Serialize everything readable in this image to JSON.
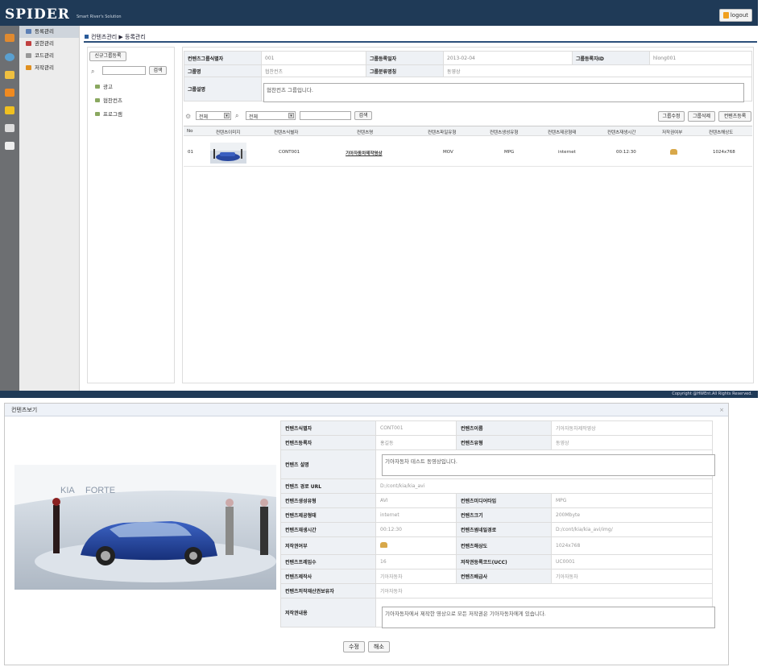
{
  "app": {
    "logo": "SPIDER",
    "tagline": "Smart River's Solution",
    "logout_label": "logout"
  },
  "sidebar": {
    "items": [
      {
        "label": "등록관리",
        "color": "#5b7fb5"
      },
      {
        "label": "권한관리",
        "color": "#c04040"
      },
      {
        "label": "코드관리",
        "color": "#999999"
      },
      {
        "label": "저작관리",
        "color": "#e09020"
      }
    ]
  },
  "breadcrumb": {
    "path": "컨텐츠관리 ▶ 등록관리"
  },
  "group_panel": {
    "new_button": "신규그룹등록",
    "search_button": "검색",
    "items": [
      "광고",
      "협찬컨츠",
      "프로그램"
    ]
  },
  "group_info": {
    "row1": [
      "컨텐츠그룹식별자",
      "001",
      "그룹등록일자",
      "2013-02-04",
      "그룹등록자ID",
      "hlong001"
    ],
    "row2": [
      "그룹명",
      "협찬컨츠",
      "그룹분류명칭",
      "동영상"
    ],
    "desc_label": "그룹설명",
    "desc_value": "협찬컨츠 그룹입니다."
  },
  "filter": {
    "select1": "전체",
    "select2": "전체",
    "search_button": "검색",
    "buttons": [
      "그룹수정",
      "그룹삭제",
      "컨텐츠등록"
    ]
  },
  "list": {
    "headers": [
      "No",
      "컨텐츠이미지",
      "컨텐츠식별자",
      "컨텐츠명",
      "컨텐츠파일유형",
      "컨텐츠생성유형",
      "컨텐츠제공형태",
      "컨텐츠재생시간",
      "저작권여부",
      "컨텐츠해상도"
    ],
    "rows": [
      {
        "no": "01",
        "id": "CONT001",
        "name": "기아자동차제작영상",
        "file_type": "MOV",
        "gen_type": "MPG",
        "provide": "internet",
        "time": "00:12:30",
        "res": "1024x768"
      }
    ]
  },
  "footer": {
    "copyright": "Copyright @HWEnt.All Rights Reserved."
  },
  "dialog": {
    "title": "컨텐츠보기",
    "fields": {
      "id_label": "컨텐츠식별자",
      "id_value": "CONT001",
      "name_label": "컨텐츠이름",
      "name_value": "기아자동차제작영상",
      "reg_label": "컨텐츠등록자",
      "reg_value": "홍길동",
      "type_label": "컨텐츠유형",
      "type_value": "동영상",
      "desc_label": "컨텐츠 설명",
      "desc_value": "기아자동차 테스트 동영상입니다.",
      "url_label": "컨텐츠 경로 URL",
      "url_value": "D:/cont/kia/kia_avi",
      "gen_label": "컨텐츠생성유형",
      "gen_value": "AVI",
      "media_label": "컨텐츠미디어타입",
      "media_value": "MPG",
      "provide_label": "컨텐츠제공형태",
      "provide_value": "internet",
      "size_label": "컨텐츠크기",
      "size_value": "200Mbyte",
      "time_label": "컨텐츠재생시간",
      "time_value": "00:12:30",
      "thumb_label": "컨텐츠썸네일경로",
      "thumb_value": "D:/cont/kia/kia_avi/img/",
      "copyright_label": "저작권여부",
      "res_label": "컨텐츠해상도",
      "res_value": "1024x768",
      "frame_label": "컨텐츠프레임수",
      "frame_value": "16",
      "ucc_label": "저작권등록코드(UCC)",
      "ucc_value": "UC0001",
      "maker_label": "컨텐츠제작사",
      "maker_value": "기아자동차",
      "dist_label": "컨텐츠배급사",
      "dist_value": "기아자동차",
      "owner_label": "컨텐츠저작재산권보유자",
      "owner_value": "기아자동차",
      "copyright_desc_label": "저작권내용",
      "copyright_desc_value": "기아자동차에서 제작한 영상으로 모든 저작권은 기아자동차에게 있습니다."
    },
    "edit_button": "수정",
    "cancel_button": "해소"
  }
}
